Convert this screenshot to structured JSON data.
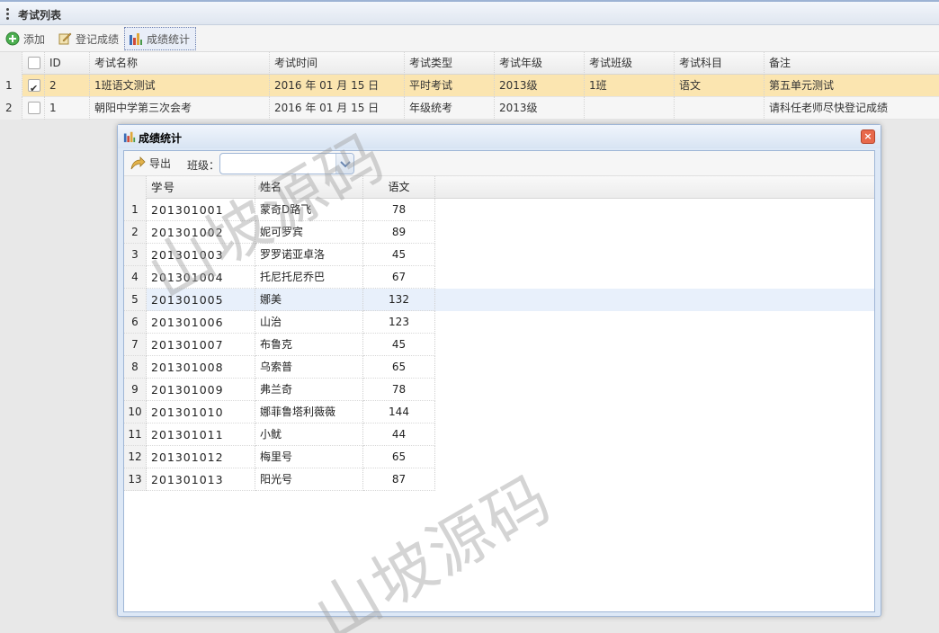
{
  "panel": {
    "title": "考试列表"
  },
  "toolbar": {
    "add_label": "添加",
    "register_label": "登记成绩",
    "stats_label": "成绩统计"
  },
  "grid": {
    "columns": [
      "ID",
      "考试名称",
      "考试时间",
      "考试类型",
      "考试年级",
      "考试班级",
      "考试科目",
      "备注"
    ],
    "rows": [
      {
        "rownum": "1",
        "checked": true,
        "id": "2",
        "name": "1班语文测试",
        "time": "2016 年 01 月 15 日",
        "type": "平时考试",
        "grade": "2013级",
        "class": "1班",
        "subject": "语文",
        "remark": "第五单元测试"
      },
      {
        "rownum": "2",
        "checked": false,
        "id": "1",
        "name": "朝阳中学第三次会考",
        "time": "2016 年 01 月 15 日",
        "type": "年级统考",
        "grade": "2013级",
        "class": "",
        "subject": "",
        "remark": "请科任老师尽快登记成绩"
      }
    ]
  },
  "dialog": {
    "title": "成绩统计",
    "close_icon": "×",
    "export_label": "导出",
    "class_label": "班级：",
    "class_value": "",
    "columns": [
      "学号",
      "姓名",
      "语文"
    ],
    "rows": [
      {
        "n": "1",
        "sid": "201301001",
        "name": "蒙奇D路飞",
        "score": "78"
      },
      {
        "n": "2",
        "sid": "201301002",
        "name": "妮可罗宾",
        "score": "89"
      },
      {
        "n": "3",
        "sid": "201301003",
        "name": "罗罗诺亚卓洛",
        "score": "45"
      },
      {
        "n": "4",
        "sid": "201301004",
        "name": "托尼托尼乔巴",
        "score": "67"
      },
      {
        "n": "5",
        "sid": "201301005",
        "name": "娜美",
        "score": "132"
      },
      {
        "n": "6",
        "sid": "201301006",
        "name": "山治",
        "score": "123"
      },
      {
        "n": "7",
        "sid": "201301007",
        "name": "布鲁克",
        "score": "45"
      },
      {
        "n": "8",
        "sid": "201301008",
        "name": "乌索普",
        "score": "65"
      },
      {
        "n": "9",
        "sid": "201301009",
        "name": "弗兰奇",
        "score": "78"
      },
      {
        "n": "10",
        "sid": "201301010",
        "name": "娜菲鲁塔利薇薇",
        "score": "144"
      },
      {
        "n": "11",
        "sid": "201301011",
        "name": "小鱿",
        "score": "44"
      },
      {
        "n": "12",
        "sid": "201301012",
        "name": "梅里号",
        "score": "65"
      },
      {
        "n": "13",
        "sid": "201301013",
        "name": "阳光号",
        "score": "87"
      }
    ]
  },
  "watermark": "山坡源码",
  "colors": {
    "selected_row": "#fbe5b0",
    "hover_row": "#e8f0fb",
    "dialog_border": "#9fb6d6",
    "close": "#e8694b"
  }
}
